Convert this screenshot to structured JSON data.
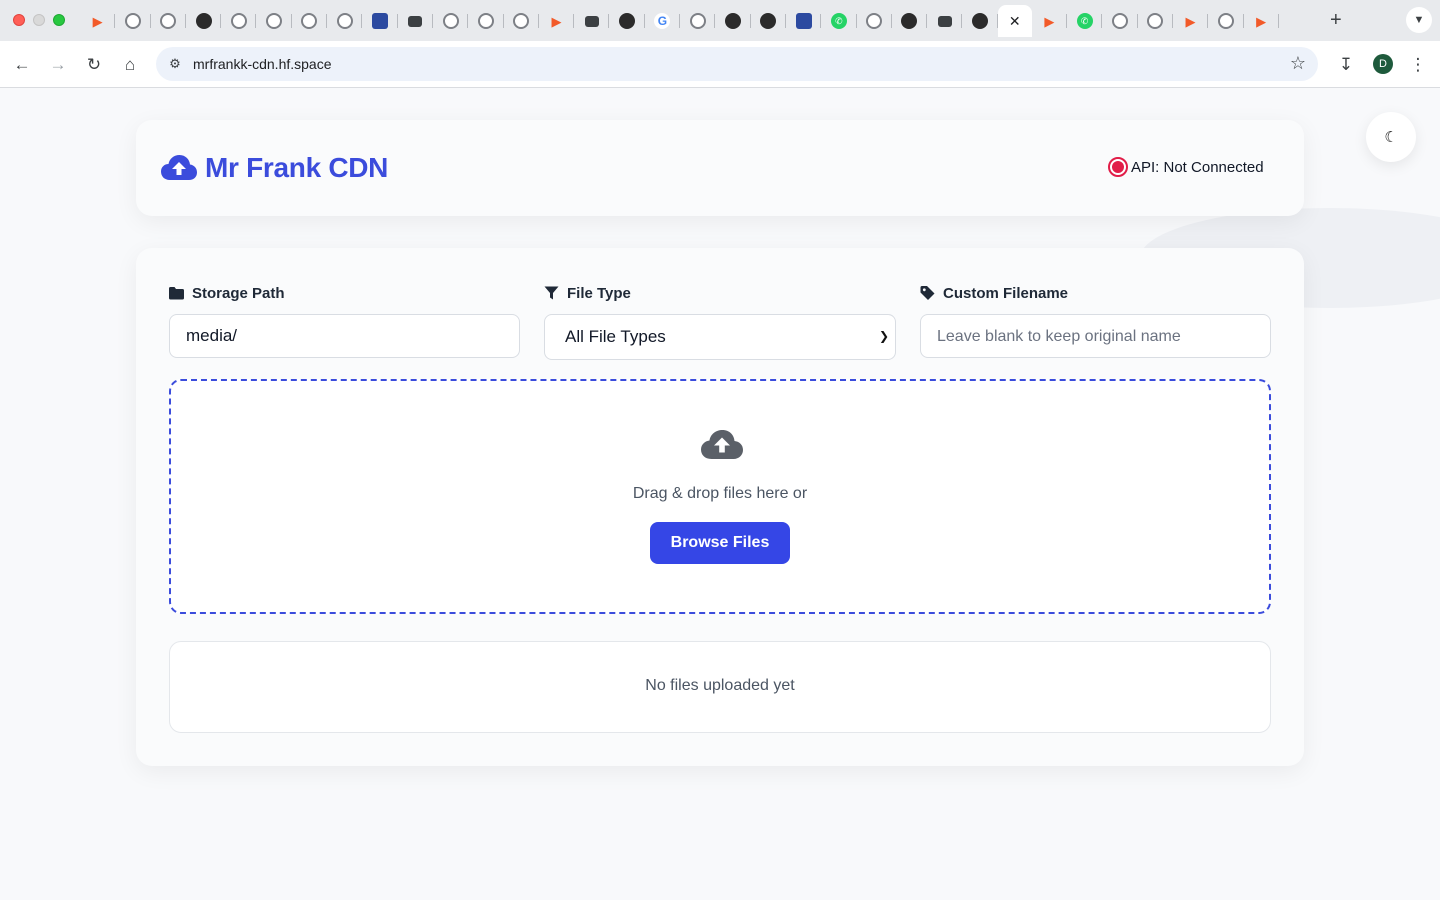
{
  "browser": {
    "url": "mrfrankk-cdn.hf.space",
    "profile_initial": "D",
    "tab_icons": [
      "orange",
      "ring",
      "ring",
      "dark",
      "ring",
      "ring",
      "ring",
      "ring",
      "blue",
      "folder",
      "ring",
      "ring",
      "ring",
      "orange",
      "folder",
      "dark",
      "g",
      "ring",
      "dark",
      "dark",
      "blue",
      "green",
      "ring",
      "dark",
      "folder",
      "dark",
      "active",
      "orange",
      "green",
      "ring",
      "ring",
      "orange",
      "ring",
      "orange"
    ]
  },
  "header": {
    "title": "Mr Frank CDN",
    "api_status": "API: Not Connected"
  },
  "form": {
    "storage_path": {
      "label": "Storage Path",
      "value": "media/"
    },
    "file_type": {
      "label": "File Type",
      "selected": "All File Types"
    },
    "custom_filename": {
      "label": "Custom Filename",
      "placeholder": "Leave blank to keep original name"
    }
  },
  "dropzone": {
    "text": "Drag & drop files here or",
    "button": "Browse Files"
  },
  "files": {
    "empty_text": "No files uploaded yet"
  },
  "colors": {
    "accent": "#3b4cdc",
    "button": "#3546e6",
    "status_error": "#e11d48"
  }
}
